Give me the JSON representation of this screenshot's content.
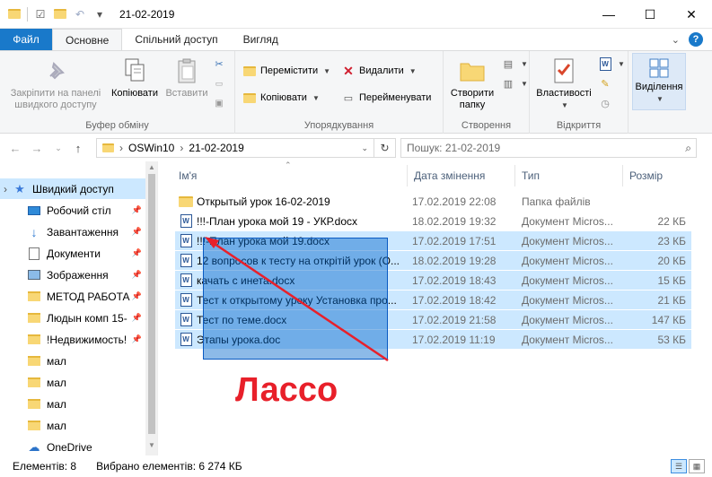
{
  "window": {
    "title": "21-02-2019",
    "minimize": "—",
    "maximize": "☐",
    "close": "✕"
  },
  "tabs": {
    "file": "Файл",
    "home": "Основне",
    "share": "Спільний доступ",
    "view": "Вигляд"
  },
  "ribbon": {
    "clipboard": {
      "label": "Буфер обміну",
      "pin": "Закріпити на панелі швидкого доступу",
      "copy": "Копіювати",
      "paste": "Вставити"
    },
    "organize": {
      "label": "Упорядкування",
      "move": "Перемістити",
      "copy_to": "Копіювати",
      "delete": "Видалити",
      "rename": "Перейменувати"
    },
    "create": {
      "label": "Створення",
      "new_folder": "Створити папку"
    },
    "open": {
      "label": "Відкриття",
      "properties": "Властивості"
    },
    "select": {
      "label": "Виділення"
    }
  },
  "address": {
    "path": [
      "OSWin10",
      "21-02-2019"
    ],
    "search_placeholder": "Пошук: 21-02-2019"
  },
  "sidebar": {
    "items": [
      {
        "label": "Швидкий доступ",
        "icon": "star-icon",
        "selected": true
      },
      {
        "label": "Робочий стіл",
        "icon": "desktop-icon",
        "pinned": true
      },
      {
        "label": "Завантаження",
        "icon": "download-icon",
        "pinned": true
      },
      {
        "label": "Документи",
        "icon": "documents-icon",
        "pinned": true
      },
      {
        "label": "Зображення",
        "icon": "pictures-icon",
        "pinned": true
      },
      {
        "label": "МЕТОД РАБОТА",
        "icon": "folder-icon",
        "pinned": true
      },
      {
        "label": "Людын комп 15-",
        "icon": "folder-icon",
        "pinned": true
      },
      {
        "label": "!Недвижимость!",
        "icon": "folder-icon",
        "pinned": true
      },
      {
        "label": "мал",
        "icon": "folder-icon"
      },
      {
        "label": "мал",
        "icon": "folder-icon"
      },
      {
        "label": "мал",
        "icon": "folder-icon"
      },
      {
        "label": "мал",
        "icon": "folder-icon"
      },
      {
        "label": "OneDrive",
        "icon": "cloud-icon"
      }
    ]
  },
  "columns": {
    "name": "Ім'я",
    "date": "Дата змінення",
    "type": "Тип",
    "size": "Розмір"
  },
  "files": [
    {
      "name": "Открытый урок 16-02-2019",
      "date": "17.02.2019 22:08",
      "type": "Папка файлів",
      "size": "",
      "icon": "folder-icon",
      "selected": false
    },
    {
      "name": "!!!-План урока мой 19 - УКР.docx",
      "date": "18.02.2019 19:32",
      "type": "Документ Micros...",
      "size": "22 КБ",
      "icon": "word-doc-icon",
      "selected": false
    },
    {
      "name": "!!!-План урока мой 19.docx",
      "date": "17.02.2019 17:51",
      "type": "Документ Micros...",
      "size": "23 КБ",
      "icon": "word-doc-icon",
      "selected": true
    },
    {
      "name": "12 вопросов к тесту на открітій урок (О...",
      "date": "18.02.2019 19:28",
      "type": "Документ Micros...",
      "size": "20 КБ",
      "icon": "word-doc-icon",
      "selected": true
    },
    {
      "name": "качать с инета.docx",
      "date": "17.02.2019 18:43",
      "type": "Документ Micros...",
      "size": "15 КБ",
      "icon": "word-doc-icon",
      "selected": true
    },
    {
      "name": "Тест к открытому уроку Установка про...",
      "date": "17.02.2019 18:42",
      "type": "Документ Micros...",
      "size": "21 КБ",
      "icon": "word-doc-icon",
      "selected": true
    },
    {
      "name": "Тест по теме.docx",
      "date": "17.02.2019 21:58",
      "type": "Документ Micros...",
      "size": "147 КБ",
      "icon": "word-doc-icon",
      "selected": true
    },
    {
      "name": "Этапы урока.doc",
      "date": "17.02.2019 11:19",
      "type": "Документ Micros...",
      "size": "53 КБ",
      "icon": "word-doc-icon",
      "selected": true
    }
  ],
  "annotation": {
    "label": "Лассо",
    "label_color": "#e8202a",
    "box_color": "#0066cc",
    "arrow_color": "#e8202a"
  },
  "status": {
    "items_count": "Елементів: 8",
    "selected": "Вибрано елементів: 6  274 КБ"
  },
  "colors": {
    "accent": "#1979ca",
    "selection": "#cce8ff"
  }
}
